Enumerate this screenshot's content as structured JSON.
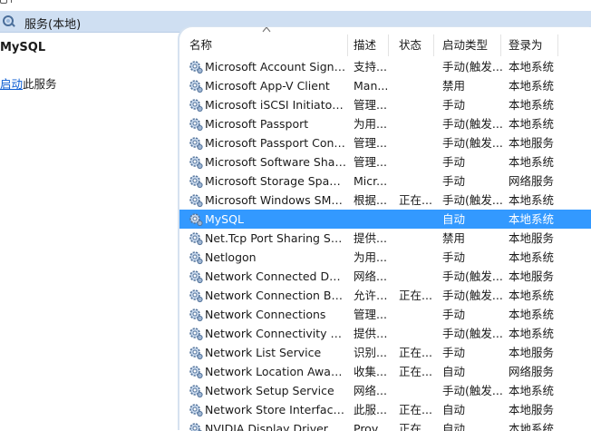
{
  "window": {
    "title": "服务(本地)"
  },
  "left_pane": {
    "service_name": "MySQL",
    "action_link": "启动",
    "action_suffix": "此服务"
  },
  "columns": {
    "name": "名称",
    "desc": "描述",
    "status": "状态",
    "startup": "启动类型",
    "logon": "登录为"
  },
  "services": [
    {
      "name": "Microsoft Account Sign-i...",
      "desc": "支持...",
      "status": "",
      "startup": "手动(触发...",
      "logon": "本地系统"
    },
    {
      "name": "Microsoft App-V Client",
      "desc": "Man...",
      "status": "",
      "startup": "禁用",
      "logon": "本地系统"
    },
    {
      "name": "Microsoft iSCSI Initiator ...",
      "desc": "管理...",
      "status": "",
      "startup": "手动",
      "logon": "本地系统"
    },
    {
      "name": "Microsoft Passport",
      "desc": "为用...",
      "status": "",
      "startup": "手动(触发...",
      "logon": "本地系统"
    },
    {
      "name": "Microsoft Passport Cont...",
      "desc": "管理...",
      "status": "",
      "startup": "手动(触发...",
      "logon": "本地服务"
    },
    {
      "name": "Microsoft Software Shad...",
      "desc": "管理...",
      "status": "",
      "startup": "手动",
      "logon": "本地系统"
    },
    {
      "name": "Microsoft Storage Space...",
      "desc": "Micr...",
      "status": "",
      "startup": "手动",
      "logon": "网络服务"
    },
    {
      "name": "Microsoft Windows SMS ...",
      "desc": "根据...",
      "status": "正在...",
      "startup": "手动(触发...",
      "logon": "本地系统"
    },
    {
      "name": "MySQL",
      "desc": "",
      "status": "",
      "startup": "自动",
      "logon": "本地系统",
      "selected": true
    },
    {
      "name": "Net.Tcp Port Sharing Ser...",
      "desc": "提供...",
      "status": "",
      "startup": "禁用",
      "logon": "本地服务"
    },
    {
      "name": "Netlogon",
      "desc": "为用...",
      "status": "",
      "startup": "手动",
      "logon": "本地系统"
    },
    {
      "name": "Network Connected Devi...",
      "desc": "网络...",
      "status": "",
      "startup": "手动(触发...",
      "logon": "本地服务"
    },
    {
      "name": "Network Connection Bro...",
      "desc": "允许 ...",
      "status": "正在...",
      "startup": "手动(触发...",
      "logon": "本地系统"
    },
    {
      "name": "Network Connections",
      "desc": "管理...",
      "status": "",
      "startup": "手动",
      "logon": "本地系统"
    },
    {
      "name": "Network Connectivity Ass...",
      "desc": "提供 ...",
      "status": "",
      "startup": "手动(触发...",
      "logon": "本地系统"
    },
    {
      "name": "Network List Service",
      "desc": "识别...",
      "status": "正在...",
      "startup": "手动",
      "logon": "本地服务"
    },
    {
      "name": "Network Location Aware...",
      "desc": "收集...",
      "status": "正在...",
      "startup": "自动",
      "logon": "网络服务"
    },
    {
      "name": "Network Setup Service",
      "desc": "网络...",
      "status": "",
      "startup": "手动(触发...",
      "logon": "本地系统"
    },
    {
      "name": "Network Store Interface ...",
      "desc": "此服...",
      "status": "正在...",
      "startup": "自动",
      "logon": "本地服务"
    },
    {
      "name": "NVIDIA Display Driver Se...",
      "desc": "Prov...",
      "status": "正在...",
      "startup": "自动",
      "logon": "本地系统"
    }
  ],
  "icons": {
    "window": "services-gear-icon",
    "row": "service-gear-icon",
    "sort": "sort-ascending-icon"
  },
  "colors": {
    "header_bg": "#cfdff2",
    "selection": "#3399ff",
    "link": "#0a5bd1"
  }
}
